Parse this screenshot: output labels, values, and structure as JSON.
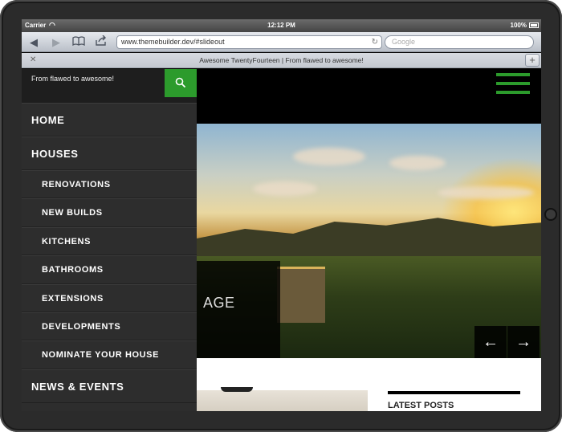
{
  "status_bar": {
    "carrier": "Carrier",
    "time": "12:12 PM",
    "battery": "100%"
  },
  "browser": {
    "url": "www.themebuilder.dev/#slideout",
    "search_placeholder": "Google",
    "tab_title": "Awesome TwentyFourteen | From flawed to awesome!"
  },
  "slideout": {
    "tagline": "From flawed to awesome!",
    "menu": [
      {
        "label": "Home",
        "level": 1
      },
      {
        "label": "Houses",
        "level": 1
      },
      {
        "label": "Renovations",
        "level": 2
      },
      {
        "label": "New Builds",
        "level": 2
      },
      {
        "label": "Kitchens",
        "level": 2
      },
      {
        "label": "Bathrooms",
        "level": 2
      },
      {
        "label": "Extensions",
        "level": 2
      },
      {
        "label": "Developments",
        "level": 2
      },
      {
        "label": "Nominate your house",
        "level": 2
      },
      {
        "label": "News & Events",
        "level": 1
      }
    ]
  },
  "hero": {
    "caption_fragment": "AGE"
  },
  "sidebar": {
    "latest_posts_title": "LATEST POSTS"
  },
  "colors": {
    "accent": "#2c9b2c",
    "menu_bg": "#2d2d2d"
  }
}
